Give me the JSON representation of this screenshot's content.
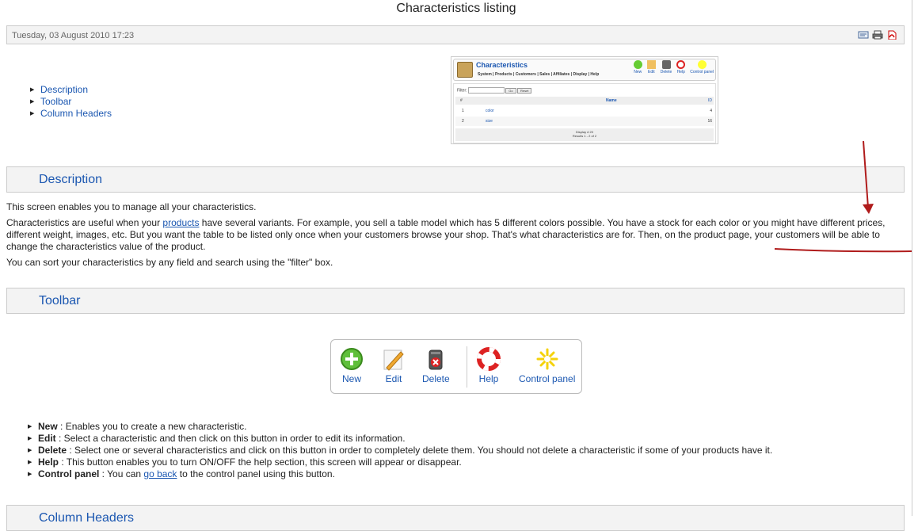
{
  "page": {
    "title": "Characteristics listing",
    "date": "Tuesday, 03 August 2010 17:23"
  },
  "toc": [
    {
      "label": "Description"
    },
    {
      "label": "Toolbar"
    },
    {
      "label": "Column Headers"
    }
  ],
  "embedded_screenshot": {
    "title": "Characteristics",
    "menu": "System | Products | Customers | Sales | Affiliates | Display | Help",
    "buttons": [
      "New",
      "Edit",
      "Delete",
      "Help",
      "Control panel"
    ],
    "filter_label": "Filter:",
    "go_label": "Go",
    "reset_label": "Reset",
    "col_num": "#",
    "col_name": "Name",
    "col_id": "ID",
    "rows": [
      {
        "num": "1",
        "name": "color",
        "id": "4"
      },
      {
        "num": "2",
        "name": "size",
        "id": "16"
      }
    ],
    "display_text": "Display # 20",
    "results_text": "Results 1 - 2 of 2"
  },
  "sections": {
    "description": "Description",
    "toolbar": "Toolbar",
    "column_headers": "Column Headers"
  },
  "description": {
    "p1": "This screen enables you to manage all your characteristics.",
    "p2_before": "Characteristics are useful when your ",
    "p2_link": "products",
    "p2_after": " have several variants. For example, you sell a table model which has 5 different colors possible. You have a stock for each color or you might have different prices, different weight, images, etc. But you want the table to be listed only once when your customers browse your shop. That's what characteristics are for. Then, on the product page, your customers will be able to change the characteristics value of the product.",
    "p3": "You can sort your characteristics by any field and search using the \"filter\" box."
  },
  "toolbar_buttons": [
    {
      "label": "New",
      "icon": "new-icon"
    },
    {
      "label": "Edit",
      "icon": "edit-icon"
    },
    {
      "label": "Delete",
      "icon": "delete-icon"
    },
    {
      "label": "Help",
      "icon": "help-icon"
    },
    {
      "label": "Control panel",
      "icon": "control-panel-icon"
    }
  ],
  "toolbar_list": [
    {
      "term": "New",
      "text": " : Enables you to create a new characteristic."
    },
    {
      "term": "Edit",
      "text": " : Select a characteristic and then click on this button in order to edit its information."
    },
    {
      "term": "Delete",
      "text": " : Select one or several characteristics and click on this button in order to completely delete them. You should not delete a characteristic if some of your products have it."
    },
    {
      "term": "Help",
      "text": " : This button enables you to turn ON/OFF the help section, this screen will appear or disappear."
    },
    {
      "term": "Control panel",
      "text": " : You can ",
      "link": "go back",
      "text_after": " to the control panel using this button."
    }
  ],
  "colors": {
    "link": "#1b57b1",
    "section_bg": "#f3f3f3",
    "annotation": "#b01c1c"
  }
}
